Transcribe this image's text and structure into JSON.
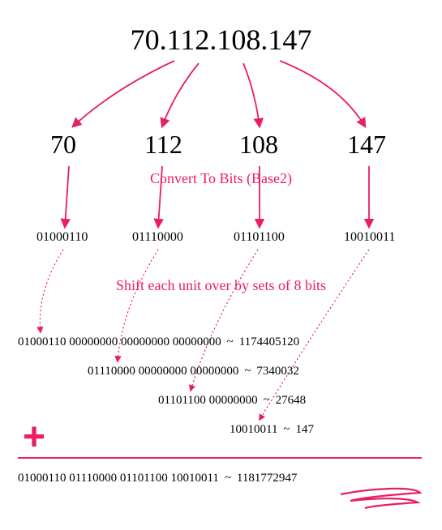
{
  "ip": "70.112.108.147",
  "octets": {
    "a": "70",
    "b": "112",
    "c": "108",
    "d": "147"
  },
  "labels": {
    "convert": "Convert To Bits (Base2)",
    "shift": "Shift each unit over by sets of 8 bits"
  },
  "binary": {
    "a": "01000110",
    "b": "01110000",
    "c": "01101100",
    "d": "10010011"
  },
  "shift_rows": {
    "r1_bits": "01000110 00000000 00000000 00000000",
    "r1_dec": "1174405120",
    "r2_bits": "01110000 00000000 00000000",
    "r2_dec": "7340032",
    "r3_bits": "01101100 00000000",
    "r3_dec": "27648",
    "r4_bits": "10010011",
    "r4_dec": "147"
  },
  "sum": {
    "bits": "01000110 01110000 01101100 10010011",
    "dec": "1181772947"
  },
  "sep": "~",
  "plus": "+"
}
